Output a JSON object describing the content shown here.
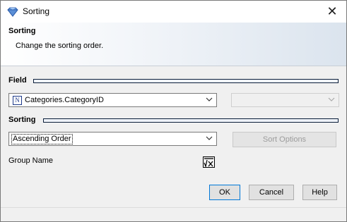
{
  "window": {
    "title": "Sorting",
    "close_glyph": "✕"
  },
  "banner": {
    "title": "Sorting",
    "subtitle": "Change the sorting order."
  },
  "field_section": {
    "heading": "Field",
    "field_combo": {
      "value": "Categories.CategoryID",
      "icon_text": "N"
    },
    "secondary_combo": {
      "value": ""
    }
  },
  "sorting_section": {
    "heading": "Sorting",
    "order_combo": {
      "value": "Ascending Order"
    },
    "sort_options_label": "Sort Options"
  },
  "group_name": {
    "label": "Group Name"
  },
  "footer": {
    "ok": "OK",
    "cancel": "Cancel",
    "help": "Help"
  },
  "colors": {
    "accent": "#0078d7",
    "section_line": "#0b1e3a"
  }
}
